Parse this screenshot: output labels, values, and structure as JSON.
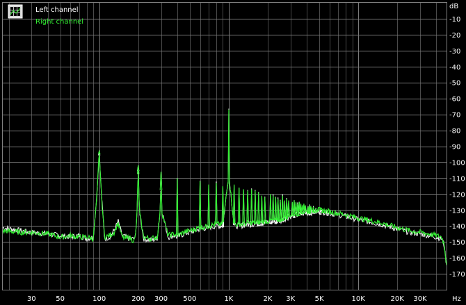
{
  "chart_data": {
    "type": "line",
    "x_scale": "log",
    "xlim": [
      18,
      48000
    ],
    "ylim": [
      -180,
      0
    ],
    "y_unit": "dB",
    "x_unit": "Hz",
    "grid": true,
    "legend_position": "top-left",
    "x_ticks": [
      {
        "value": 30,
        "label": "30"
      },
      {
        "value": 50,
        "label": "50"
      },
      {
        "value": 100,
        "label": "100"
      },
      {
        "value": 200,
        "label": "200"
      },
      {
        "value": 300,
        "label": "300"
      },
      {
        "value": 500,
        "label": "500"
      },
      {
        "value": 1000,
        "label": "1K"
      },
      {
        "value": 2000,
        "label": "2K"
      },
      {
        "value": 3000,
        "label": "3K"
      },
      {
        "value": 5000,
        "label": "5K"
      },
      {
        "value": 10000,
        "label": "10K"
      },
      {
        "value": 20000,
        "label": "20K"
      },
      {
        "value": 30000,
        "label": "30K"
      }
    ],
    "y_ticks": [
      -10,
      -20,
      -30,
      -40,
      -50,
      -60,
      -70,
      -80,
      -90,
      -100,
      -110,
      -120,
      -130,
      -140,
      -150,
      -160,
      -170
    ],
    "series": [
      {
        "name": "Left channel",
        "color": "#ffffff",
        "x": [
          18,
          25,
          30,
          40,
          50,
          60,
          70,
          80,
          90,
          96,
          100,
          104,
          110,
          120,
          130,
          140,
          150,
          160,
          170,
          180,
          190,
          196,
          200,
          204,
          220,
          250,
          280,
          296,
          300,
          304,
          340,
          380,
          400,
          450,
          500,
          600,
          700,
          800,
          900,
          990,
          1000,
          1010,
          1100,
          1200,
          1500,
          2000,
          2500,
          3000,
          4000,
          5000,
          6000,
          8000,
          10000,
          15000,
          20000,
          25000,
          30000,
          35000,
          40000,
          44000,
          46000,
          48000
        ],
        "values": [
          -141,
          -143,
          -144,
          -145,
          -146,
          -147,
          -146,
          -148,
          -147,
          -120,
          -94,
          -120,
          -148,
          -147,
          -143,
          -137,
          -146,
          -147,
          -148,
          -148,
          -148,
          -130,
          -103,
          -130,
          -148,
          -149,
          -148,
          -130,
          -107,
          -130,
          -147,
          -146,
          -147,
          -145,
          -144,
          -142,
          -141,
          -140,
          -140,
          -110,
          -61,
          -110,
          -140,
          -140,
          -139,
          -138,
          -137,
          -134,
          -132,
          -131,
          -132,
          -134,
          -136,
          -139,
          -142,
          -144,
          -145,
          -146,
          -147,
          -148,
          -152,
          -165
        ]
      },
      {
        "name": "Right channel",
        "color": "#33ee33",
        "x": [
          18,
          25,
          30,
          40,
          50,
          60,
          70,
          80,
          90,
          96,
          100,
          104,
          110,
          120,
          130,
          140,
          150,
          160,
          170,
          180,
          190,
          196,
          200,
          204,
          220,
          250,
          280,
          296,
          300,
          304,
          340,
          380,
          400,
          450,
          500,
          600,
          700,
          800,
          900,
          990,
          1000,
          1010,
          1100,
          1200,
          1500,
          2000,
          2500,
          3000,
          4000,
          5000,
          6000,
          8000,
          10000,
          15000,
          20000,
          25000,
          30000,
          35000,
          40000,
          44000,
          46000,
          48000
        ],
        "values": [
          -143,
          -144,
          -144,
          -145,
          -147,
          -146,
          -147,
          -147,
          -148,
          -121,
          -93,
          -121,
          -147,
          -146,
          -144,
          -138,
          -147,
          -148,
          -147,
          -149,
          -148,
          -131,
          -102,
          -131,
          -147,
          -148,
          -147,
          -131,
          -106,
          -131,
          -146,
          -145,
          -146,
          -144,
          -143,
          -141,
          -140,
          -139,
          -139,
          -111,
          -60,
          -111,
          -139,
          -139,
          -138,
          -137,
          -136,
          -133,
          -131,
          -130,
          -131,
          -133,
          -135,
          -138,
          -141,
          -143,
          -144,
          -145,
          -146,
          -147,
          -151,
          -164
        ]
      }
    ],
    "harmonics": {
      "frequencies": [
        100,
        200,
        300,
        400,
        600,
        700,
        800,
        900,
        1100,
        1200,
        1300,
        1400,
        1500,
        1600,
        1700,
        1800,
        1900,
        2100,
        2200,
        2300,
        2400,
        2500,
        2600,
        2700,
        2800,
        2900,
        3100,
        3200,
        3300,
        3400,
        3500,
        3600,
        3700,
        3800,
        3900,
        4100,
        4200,
        4300,
        4500,
        4700,
        4900,
        5100,
        5300,
        5500,
        5800
      ],
      "levels": [
        -93,
        -102,
        -106,
        -110,
        -112,
        -114,
        -113,
        -115,
        -114,
        -116,
        -117,
        -118,
        -117,
        -118,
        -119,
        -121,
        -122,
        -120,
        -121,
        -122,
        -123,
        -124,
        -121,
        -124,
        -123,
        -124,
        -125,
        -124,
        -125,
        -126,
        -125,
        -126,
        -127,
        -126,
        -127,
        -128,
        -127,
        -128,
        -128,
        -129,
        -129,
        -130,
        -130,
        -131,
        -131
      ]
    }
  },
  "legend": [
    {
      "label": "Left channel",
      "color": "#ffffff"
    },
    {
      "label": "Right channel",
      "color": "#33ee33"
    }
  ],
  "y_unit_label": "dB",
  "x_unit_label": "Hz",
  "legend_icon": "grid-icon"
}
